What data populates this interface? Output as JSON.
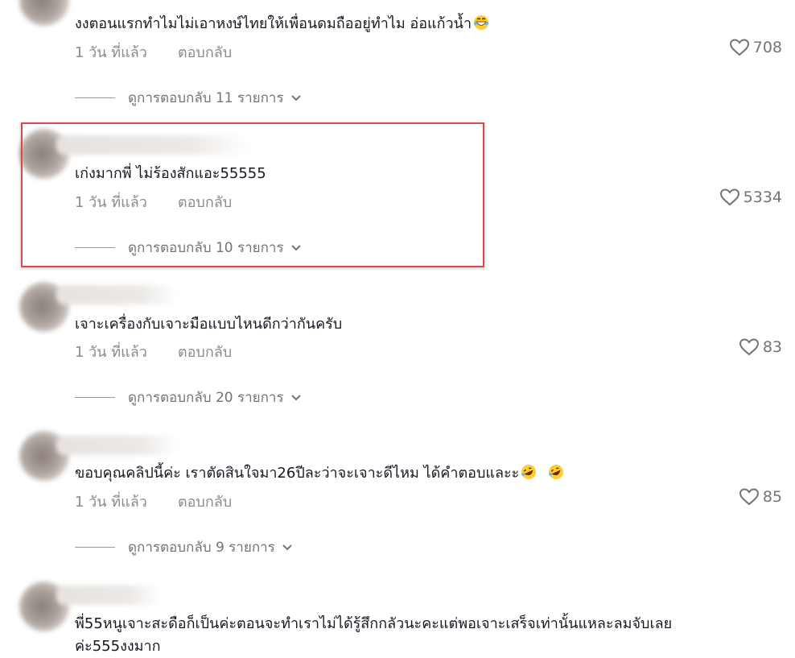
{
  "comments": [
    {
      "text": "งงตอนแรกทำไมไม่เอาหงษ์ไทยให้เพื่อนดมถืออยู่ทำไม อ่อแก้วน้ำ",
      "time": "1 วัน ที่แล้ว",
      "reply": "ตอบกลับ",
      "likes": "708",
      "view_replies": "ดูการตอบกลับ 11 รายการ",
      "emoji": "laugh-emoji"
    },
    {
      "text": "เก่งมากพี่ ไม่ร้องสักแอะ55555",
      "time": "1 วัน ที่แล้ว",
      "reply": "ตอบกลับ",
      "likes": "5334",
      "view_replies": "ดูการตอบกลับ 10 รายการ"
    },
    {
      "text": "เจาะเครื่องกับเจาะมือแบบไหนดีกว่ากันครับ",
      "time": "1 วัน ที่แล้ว",
      "reply": "ตอบกลับ",
      "likes": "83",
      "view_replies": "ดูการตอบกลับ 20 รายการ"
    },
    {
      "text": "ขอบคุณคลิปนี้ค่ะ เราตัดสินใจมา26ปีละว่าจะเจาะดีไหม ได้คำตอบและะ",
      "time": "1 วัน ที่แล้ว",
      "reply": "ตอบกลับ",
      "likes": "85",
      "view_replies": "ดูการตอบกลับ 9 รายการ",
      "emoji": "rofl-emoji"
    },
    {
      "text_line1": "พี่55หนูเจาะสะดือก็เป็นค่ะตอนจะทำเราไม่ได้รู้สึกกลัวนะคะแต่พอเจาะเสร็จเท่านั้นแหละลมจับเลย",
      "text_line2": "ค่ะ555งงมาก"
    }
  ],
  "colors": {
    "highlight": "#d94b4b",
    "meta": "#8a8b91",
    "text": "#161823"
  }
}
